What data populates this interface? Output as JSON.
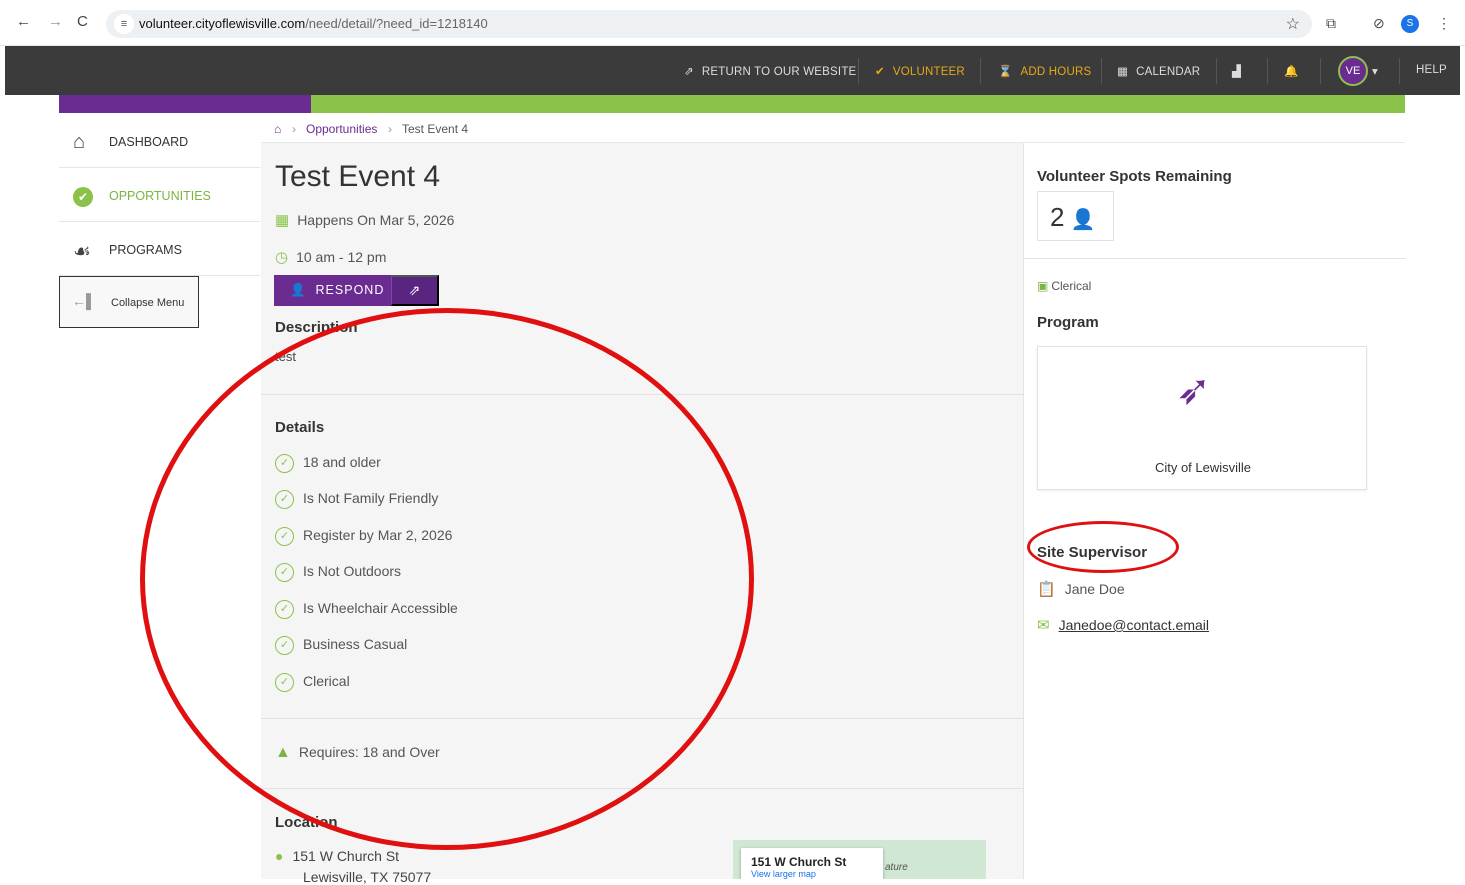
{
  "browser": {
    "url_host": "volunteer.cityoflewisville.com",
    "url_path": "/need/detail/?need_id=1218140",
    "profile_initial": "S"
  },
  "topnav": {
    "return_label": "RETURN TO OUR WEBSITE",
    "volunteer_label": "VOLUNTEER",
    "add_hours_label": "ADD HOURS",
    "calendar_label": "CALENDAR",
    "avatar_initials": "VE",
    "help_label": "HELP"
  },
  "colors": {
    "brand_purple": "#6a2c91",
    "accent_green": "#8bc34a",
    "nav_dark": "#3b3b3b",
    "annotation_red": "#e01010"
  },
  "sidebar": {
    "items": [
      {
        "label": "DASHBOARD",
        "icon": "house-icon"
      },
      {
        "label": "OPPORTUNITIES",
        "icon": "check-circle-icon"
      },
      {
        "label": "PROGRAMS",
        "icon": "hand-heart-icon"
      }
    ],
    "collapse_label": "Collapse Menu"
  },
  "breadcrumb": {
    "link": "Opportunities",
    "current": "Test Event 4"
  },
  "event": {
    "title": "Test Event 4",
    "date": "Happens On Mar 5, 2026",
    "time": "10 am - 12 pm",
    "respond_label": "RESPOND",
    "description_heading": "Description",
    "description_text": "test",
    "details_heading": "Details",
    "details": [
      "18 and older",
      "Is Not Family Friendly",
      "Register by Mar 2, 2026",
      "Is Not Outdoors",
      "Is Wheelchair Accessible",
      "Business Casual",
      "Clerical"
    ],
    "requirement": "Requires: 18 and Over",
    "location_heading": "Location",
    "address_line1": "151 W Church St",
    "address_line2": "Lewisville, TX 75077",
    "map_card_title": "151 W Church St",
    "map_card_link": "View larger map",
    "map_feature_text": "ature"
  },
  "right_panel": {
    "spots_heading": "Volunteer Spots Remaining",
    "spots_count": "2",
    "category_tag": "Clerical",
    "program_heading": "Program",
    "program_name": "City of Lewisville",
    "supervisor_heading": "Site Supervisor",
    "supervisor_name": "Jane Doe",
    "supervisor_email": "Janedoe@contact.email"
  }
}
